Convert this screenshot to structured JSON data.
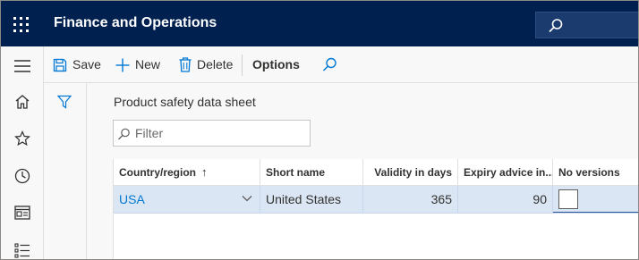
{
  "header": {
    "app_title": "Finance and Operations"
  },
  "actions": {
    "save": "Save",
    "new": "New",
    "delete": "Delete",
    "options": "Options"
  },
  "page": {
    "title": "Product safety data sheet",
    "filter_placeholder": "Filter"
  },
  "grid": {
    "columns": {
      "country_region": "Country/region",
      "sort_indicator": "↑",
      "short_name": "Short name",
      "validity_in_days": "Validity in days",
      "expiry_advice": "Expiry advice in...",
      "no_versions": "No versions"
    },
    "rows": [
      {
        "country_region": "USA",
        "short_name": "United States",
        "validity_in_days": "365",
        "expiry_advice": "90",
        "no_versions": false
      }
    ]
  },
  "colors": {
    "top_bar": "#002050",
    "accent": "#0078d4",
    "selected_row": "#dbe6f4"
  },
  "icons": {
    "waffle": "waffle-icon",
    "search": "search-icon",
    "hamburger": "hamburger-icon",
    "home": "home-icon",
    "favorites": "star-icon",
    "recent": "clock-icon",
    "workspaces": "workspace-icon",
    "modules": "list-icon",
    "save": "save-icon",
    "new": "plus-icon",
    "delete": "trash-icon",
    "filter": "filter-icon"
  }
}
